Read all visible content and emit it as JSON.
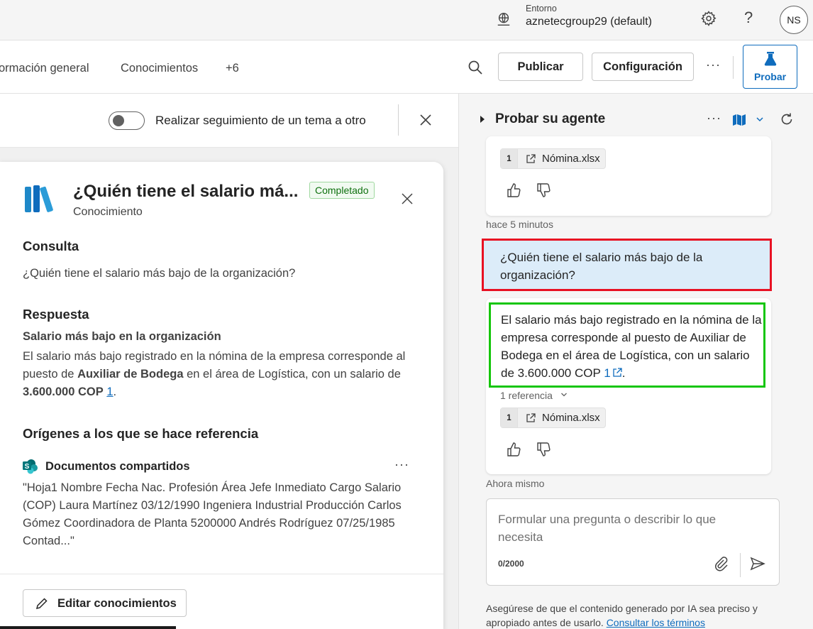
{
  "topbar": {
    "env_label": "Entorno",
    "env_value": "aznetecgroup29 (default)",
    "help": "?",
    "avatar_initials": "NS"
  },
  "nav": {
    "tabs": [
      "ormación general",
      "Conocimientos",
      "+6"
    ],
    "publish_label": "Publicar",
    "config_label": "Configuración",
    "more": "···",
    "test_label": "Probar"
  },
  "left": {
    "toggle_label": "Realizar seguimiento de un tema a otro",
    "toggle_on": false,
    "card": {
      "title": "¿Quién tiene el salario má...",
      "subtitle": "Conocimiento",
      "badge": "Completado",
      "query_heading": "Consulta",
      "query_text": "¿Quién tiene el salario más bajo de la organización?",
      "answer_heading": "Respuesta",
      "answer_subheading": "Salario más bajo en la organización",
      "answer_part1": "El salario más bajo registrado en la nómina de la empresa corresponde al puesto de ",
      "answer_bold1": "Auxiliar de Bodega",
      "answer_part2": " en el área de Logística, con un salario de ",
      "answer_bold2": "3.600.000 COP",
      "answer_part3": " ",
      "answer_ref": "1",
      "answer_end": ".",
      "sources_heading": "Orígenes a los que se hace referencia",
      "source_name": "Documentos compartidos",
      "source_more": "···",
      "source_quote": "\"Hoja1 Nombre Fecha Nac. Profesión Área Jefe Inmediato Cargo Salario (COP) Laura Martínez 03/12/1990 Ingeniera Industrial Producción Carlos Gómez Coordinadora de Planta 5200000 Andrés Rodríguez 07/25/1985 Contad...\"",
      "edit_button": "Editar conocimientos"
    }
  },
  "right": {
    "title": "Probar su agente",
    "more": "···",
    "chip_top": {
      "num": "1",
      "label": "Nómina.xlsx"
    },
    "timestamp1": "hace 5 minutos",
    "user_message": "¿Quién tiene el salario más bajo de la organización?",
    "bot_message": "El salario más bajo registrado en la nómina de la empresa corresponde al puesto de Auxiliar de Bodega en el área de Logística, con un salario de 3.600.000 COP ",
    "bot_ref": "1",
    "bot_end": ".",
    "ref_count": "1 referencia",
    "chip_bottom": {
      "num": "1",
      "label": "Nómina.xlsx"
    },
    "timestamp2": "Ahora mismo",
    "input_placeholder": "Formular una pregunta o describir lo que necesita",
    "char_count": "0/2000",
    "disclaimer": "Asegúrese de que el contenido generado por IA sea preciso y apropiado antes de usarlo.",
    "terms_link": "Consultar los términos"
  }
}
